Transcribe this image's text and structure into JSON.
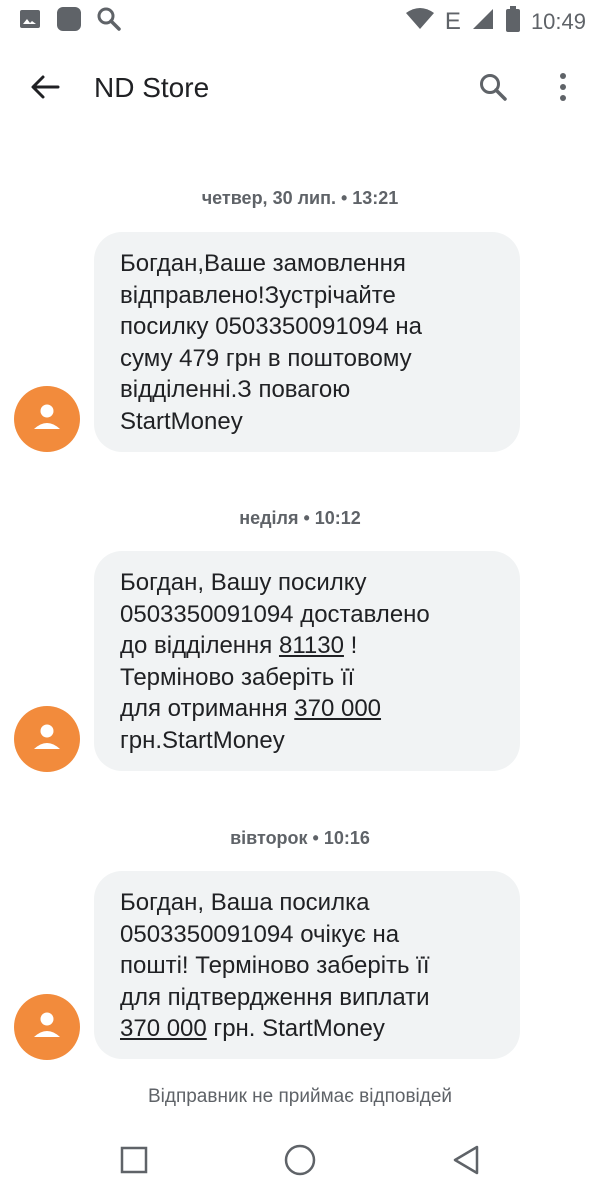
{
  "status_bar": {
    "time": "10:49",
    "network": "E",
    "icons": [
      "gallery-icon",
      "app-icon",
      "search-icon",
      "wifi-icon",
      "signal-icon",
      "battery-icon"
    ]
  },
  "app_bar": {
    "title": "ND Store",
    "icons": [
      "back-arrow-icon",
      "search-icon",
      "more-vert-icon"
    ]
  },
  "messages": [
    {
      "date": "четвер, 30 лип. • 13:21",
      "text": "Богдан,Ваше замовлення\nвідправлено!Зустрічайте\nпосилку 0503350091094   на\nсуму  479 грн в поштовому\nвідділенні.З повагою\nStartMoney"
    },
    {
      "date": "неділя • 10:12",
      "parts": [
        "Богдан, Вашу посилку\n0503350091094 доставлено\nдо відділення ",
        "81130",
        " !\nТерміново заберіть її\nдля отримання ",
        "370 000",
        "\nгрн.StartMoney"
      ]
    },
    {
      "date": "вівторок • 10:16",
      "parts": [
        "Богдан, Ваша посилка\n0503350091094 очікує на\nпошті! Терміново заберіть її\nдля підтвердження виплати\n",
        "370 000",
        " грн. StartMoney"
      ]
    }
  ],
  "footer": {
    "note": "Відправник не приймає відповідей"
  },
  "nav_bar": {
    "icons": [
      "recents-square-icon",
      "home-circle-icon",
      "back-triangle-icon"
    ]
  },
  "colors": {
    "avatar": "#f28b3c",
    "bubble": "#f1f3f4",
    "text": "#202124",
    "secondary": "#5f6368"
  }
}
